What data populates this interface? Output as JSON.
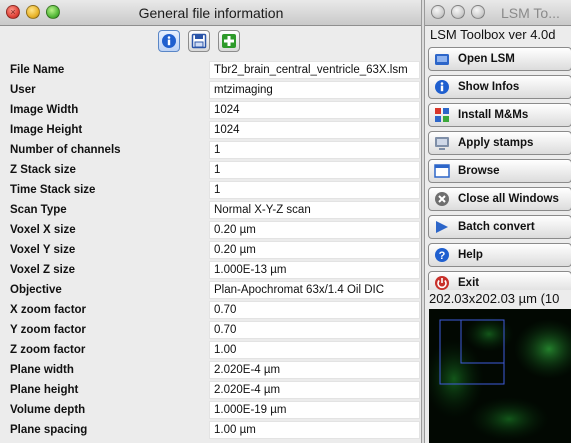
{
  "info_window": {
    "title": "General file information",
    "toolbar": [
      {
        "name": "info-icon"
      },
      {
        "name": "save-icon"
      },
      {
        "name": "add-icon"
      }
    ],
    "rows": [
      {
        "label": "File Name",
        "value": "Tbr2_brain_central_ventricle_63X.lsm"
      },
      {
        "label": "User",
        "value": "mtzimaging"
      },
      {
        "label": "Image Width",
        "value": "1024"
      },
      {
        "label": "Image Height",
        "value": "1024"
      },
      {
        "label": "Number of channels",
        "value": "1"
      },
      {
        "label": "Z Stack size",
        "value": "1"
      },
      {
        "label": "Time Stack size",
        "value": "1"
      },
      {
        "label": "Scan Type",
        "value": "Normal X-Y-Z scan"
      },
      {
        "label": "Voxel X size",
        "value": "0.20 µm"
      },
      {
        "label": "Voxel Y size",
        "value": "0.20 µm"
      },
      {
        "label": "Voxel Z size",
        "value": "1.000E-13 µm"
      },
      {
        "label": "Objective",
        "value": "Plan-Apochromat 63x/1.4 Oil DIC"
      },
      {
        "label": "X zoom factor",
        "value": "0.70"
      },
      {
        "label": "Y zoom factor",
        "value": "0.70"
      },
      {
        "label": "Z zoom factor",
        "value": "1.00"
      },
      {
        "label": "Plane width",
        "value": "2.020E-4 µm"
      },
      {
        "label": "Plane height",
        "value": "2.020E-4 µm"
      },
      {
        "label": "Volume depth",
        "value": "1.000E-19 µm"
      },
      {
        "label": "Plane spacing",
        "value": "1.00 µm"
      }
    ]
  },
  "toolbox_window": {
    "title": "LSM To...",
    "version_label": "LSM Toolbox  ver 4.0d",
    "buttons": [
      {
        "label": "Open LSM",
        "icon": "open-icon"
      },
      {
        "label": "Show Infos",
        "icon": "info-icon"
      },
      {
        "label": "Install M&Ms",
        "icon": "install-icon"
      },
      {
        "label": "Apply stamps",
        "icon": "stamp-icon"
      },
      {
        "label": "Browse",
        "icon": "browse-icon"
      },
      {
        "label": "Close all Windows",
        "icon": "close-all-icon"
      },
      {
        "label": "Batch convert",
        "icon": "batch-icon"
      },
      {
        "label": "Help",
        "icon": "help-icon"
      },
      {
        "label": "Exit",
        "icon": "exit-icon"
      }
    ]
  },
  "image_window": {
    "dimensions": "202.03x202.03 µm (10"
  },
  "colors": {
    "accent": "#1f5fcf",
    "image_background": "#000000",
    "fluorescence": "#1e8c2a",
    "roi": "#3f5bd9"
  }
}
